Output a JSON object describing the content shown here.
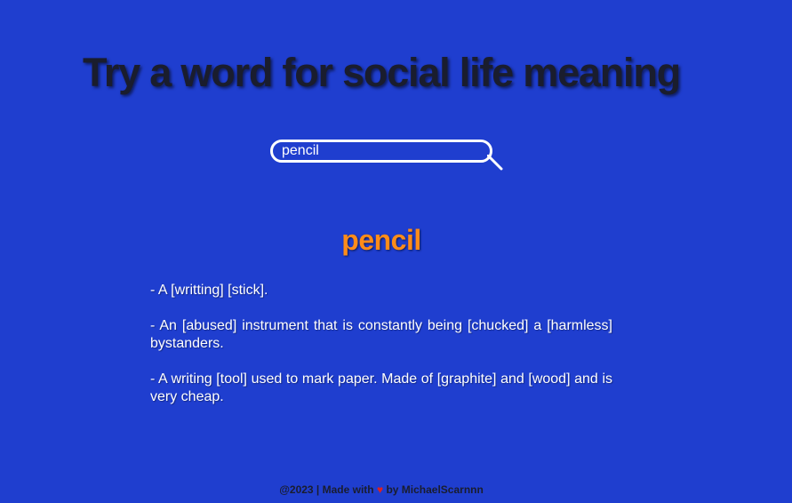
{
  "header": {
    "title": "Try a word for social life meaning"
  },
  "search": {
    "value": "pencil"
  },
  "result": {
    "word": "pencil",
    "definitions": [
      "- A [writting] [stick].",
      "- An [abused] instrument that is constantly being [chucked] a [harmless] bystanders.",
      "- A writing [tool] used to mark paper. Made of [graphite] and [wood] and is very cheap."
    ]
  },
  "footer": {
    "prefix": "@2023 | Made with",
    "heart": "♥",
    "suffix": "by MichaelScarnnn"
  },
  "colors": {
    "background": "#1f3ecf",
    "title": "#1a1d2e",
    "word": "#ff8c1a",
    "text": "#ffffff",
    "heart": "#e02020"
  },
  "icons": {
    "search": "search-icon",
    "heart": "heart-icon"
  }
}
